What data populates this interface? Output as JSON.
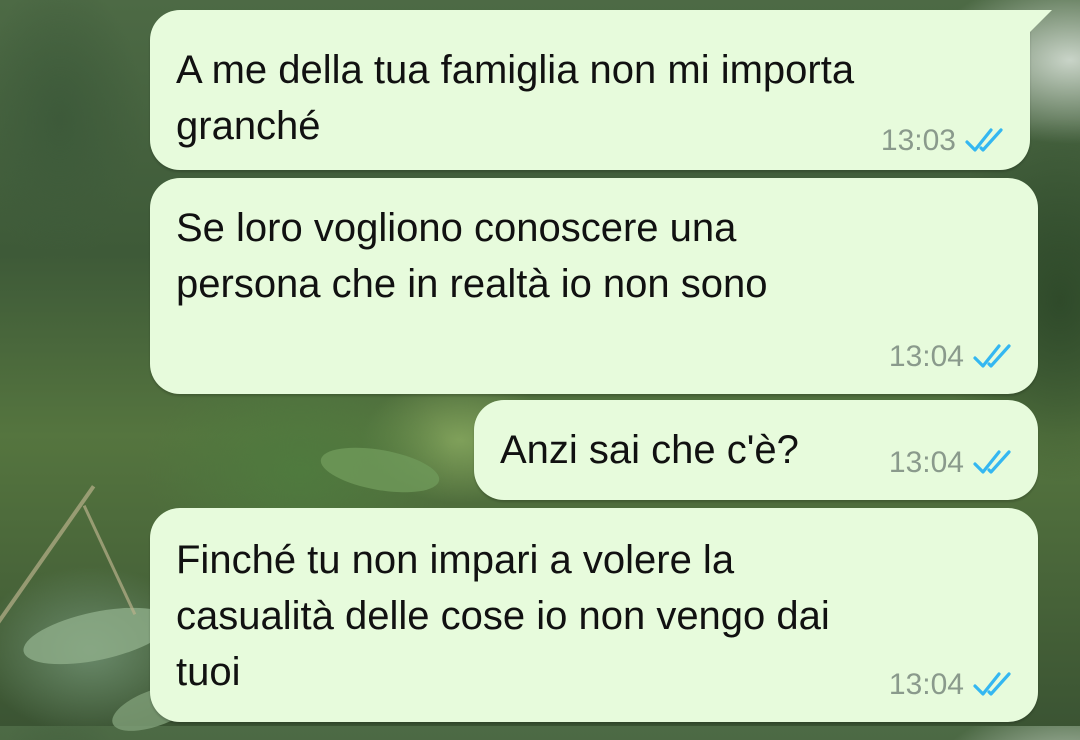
{
  "messages": [
    {
      "text": "A me della tua famiglia non mi importa\ngranché",
      "time": "13:03",
      "status": "read"
    },
    {
      "text": "Se loro vogliono conoscere una\npersona che in realtà io non sono",
      "time": "13:04",
      "status": "read"
    },
    {
      "text": "Anzi sai che c'è?",
      "time": "13:04",
      "status": "read"
    },
    {
      "text": "Finché tu non impari a volere la\ncasualità delle cose io non vengo dai\ntuoi",
      "time": "13:04",
      "status": "read"
    }
  ],
  "colors": {
    "bubble_outgoing": "#e7fbdc",
    "read_ticks": "#34b7f1",
    "timestamp": "#8a9a8c"
  }
}
